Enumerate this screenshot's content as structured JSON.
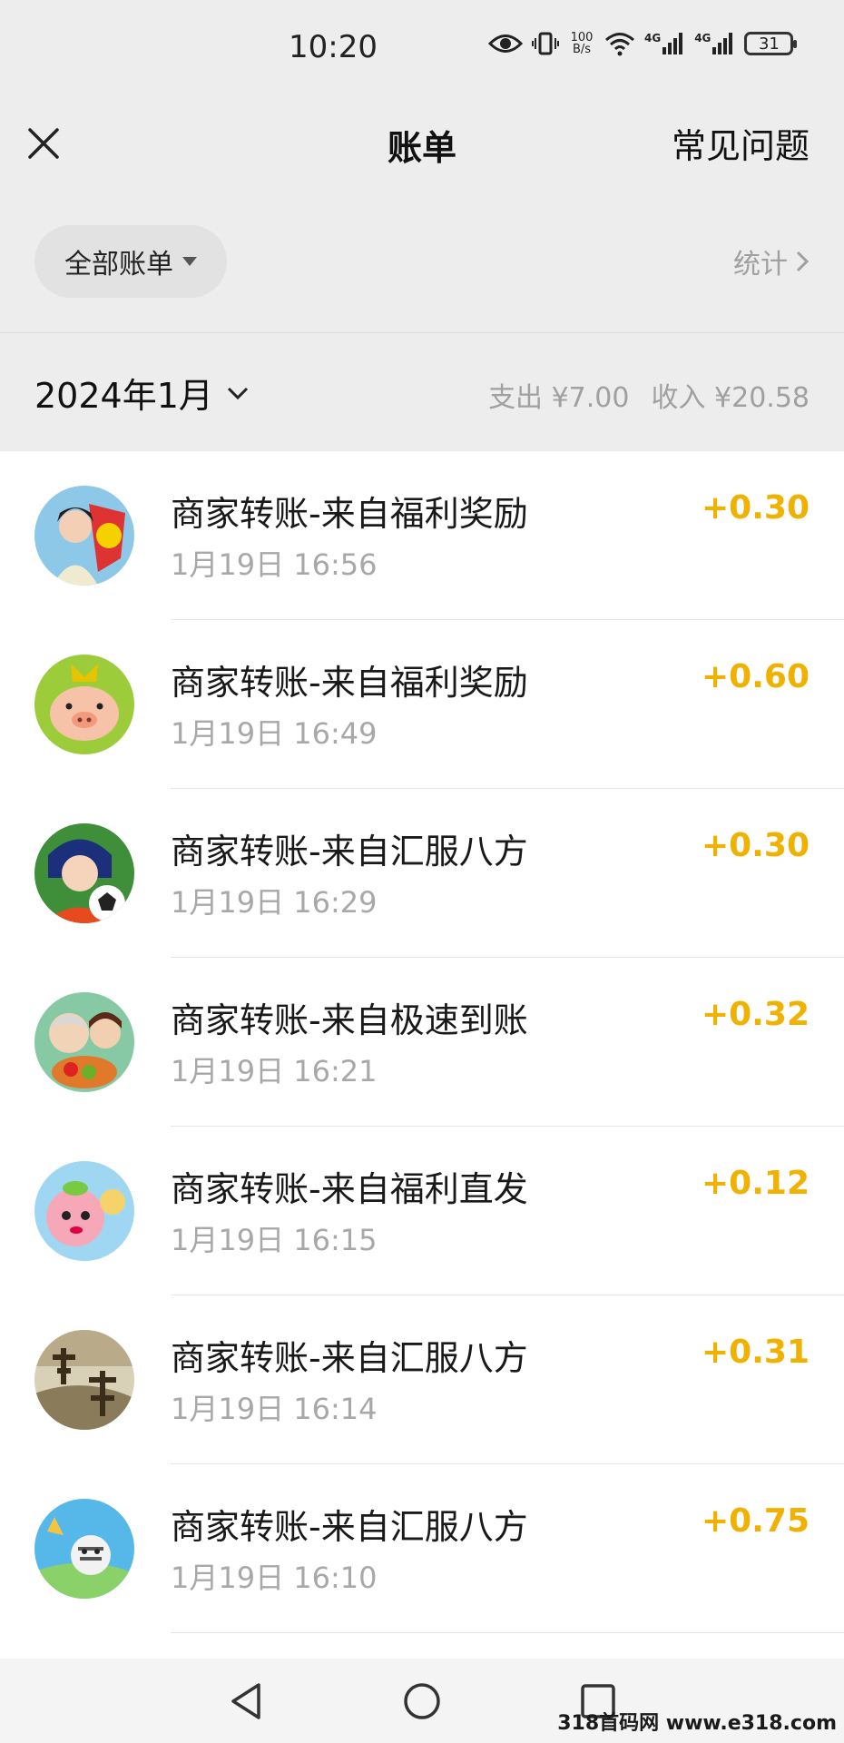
{
  "status_bar": {
    "time": "10:20",
    "net_speed_value": "100",
    "net_speed_unit": "B/s",
    "signal1_label": "4G",
    "signal2_label": "4G",
    "battery": "31",
    "icons": [
      "eye-icon",
      "vibrate-icon",
      "wifi-icon",
      "signal-icon",
      "signal-icon",
      "battery-icon"
    ]
  },
  "header": {
    "title": "账单",
    "faq": "常见问题",
    "close_icon": "close-icon"
  },
  "filter": {
    "label": "全部账单",
    "stats_label": "统计"
  },
  "month": {
    "label": "2024年1月",
    "expense": "支出 ¥7.00",
    "income": "收入 ¥20.58"
  },
  "accent_color": "#f0b100",
  "transactions": [
    {
      "title": "商家转账-来自福利奖励",
      "time": "1月19日 16:56",
      "amount": "+0.30"
    },
    {
      "title": "商家转账-来自福利奖励",
      "time": "1月19日 16:49",
      "amount": "+0.60"
    },
    {
      "title": "商家转账-来自汇服八方",
      "time": "1月19日 16:29",
      "amount": "+0.30"
    },
    {
      "title": "商家转账-来自极速到账",
      "time": "1月19日 16:21",
      "amount": "+0.32"
    },
    {
      "title": "商家转账-来自福利直发",
      "time": "1月19日 16:15",
      "amount": "+0.12"
    },
    {
      "title": "商家转账-来自汇服八方",
      "time": "1月19日 16:14",
      "amount": "+0.31"
    },
    {
      "title": "商家转账-来自汇服八方",
      "time": "1月19日 16:10",
      "amount": "+0.75"
    }
  ],
  "system_nav": {
    "back": "back-icon",
    "home": "home-icon",
    "recents": "recents-icon"
  },
  "watermark": "318首码网 www.e318.com"
}
